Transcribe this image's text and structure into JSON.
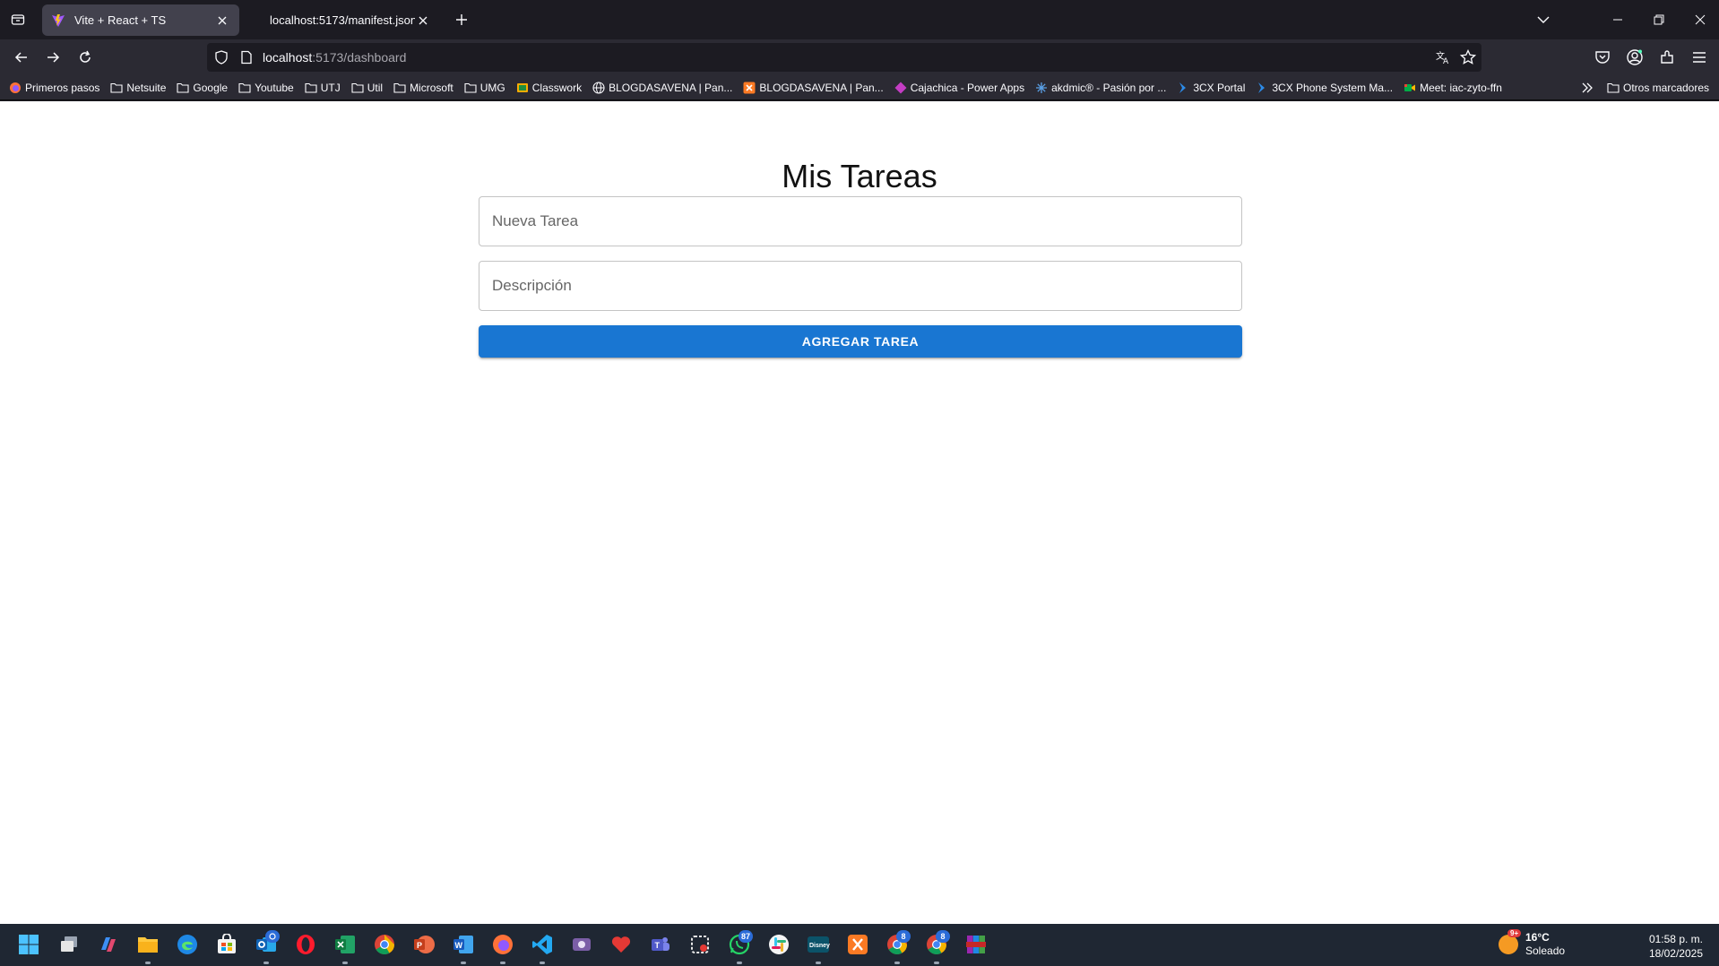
{
  "browser": {
    "tabs": [
      {
        "title": "Vite + React + TS",
        "active": true
      },
      {
        "title": "localhost:5173/manifest.json",
        "active": false
      }
    ],
    "url": {
      "host": "localhost",
      "rest": ":5173/dashboard"
    },
    "bookmarks": [
      {
        "label": "Primeros pasos",
        "icon": "firefox-icon"
      },
      {
        "label": "Netsuite",
        "icon": "folder-icon"
      },
      {
        "label": "Google",
        "icon": "folder-icon"
      },
      {
        "label": "Youtube",
        "icon": "folder-icon"
      },
      {
        "label": "UTJ",
        "icon": "folder-icon"
      },
      {
        "label": "Util",
        "icon": "folder-icon"
      },
      {
        "label": "Microsoft",
        "icon": "folder-icon"
      },
      {
        "label": "UMG",
        "icon": "folder-icon"
      },
      {
        "label": "Classwork",
        "icon": "classroom-icon"
      },
      {
        "label": "BLOGDASAVENA | Pan...",
        "icon": "globe-icon"
      },
      {
        "label": "BLOGDASAVENA | Pan...",
        "icon": "xampp-icon"
      },
      {
        "label": "Cajachica - Power Apps",
        "icon": "powerapps-icon"
      },
      {
        "label": "akdmic® - Pasión por ...",
        "icon": "akdmic-icon"
      },
      {
        "label": "3CX Portal",
        "icon": "3cx-icon"
      },
      {
        "label": "3CX Phone System Ma...",
        "icon": "3cx-icon"
      },
      {
        "label": "Meet: iac-zyto-ffn",
        "icon": "meet-icon"
      }
    ],
    "other_bookmarks": "Otros marcadores"
  },
  "app": {
    "title": "Mis Tareas",
    "task_placeholder": "Nueva Tarea",
    "description_placeholder": "Descripción",
    "add_button": "AGREGAR TAREA",
    "colors": {
      "primary": "#1976d2"
    }
  },
  "taskbar": {
    "badges": {
      "whatsapp": "87",
      "chrome_a": "8",
      "chrome_b": "8"
    },
    "weather": {
      "temp": "16°C",
      "condition": "Soleado",
      "badge": "9+"
    },
    "clock": {
      "time": "01:58 p. m.",
      "date": "18/02/2025"
    }
  }
}
